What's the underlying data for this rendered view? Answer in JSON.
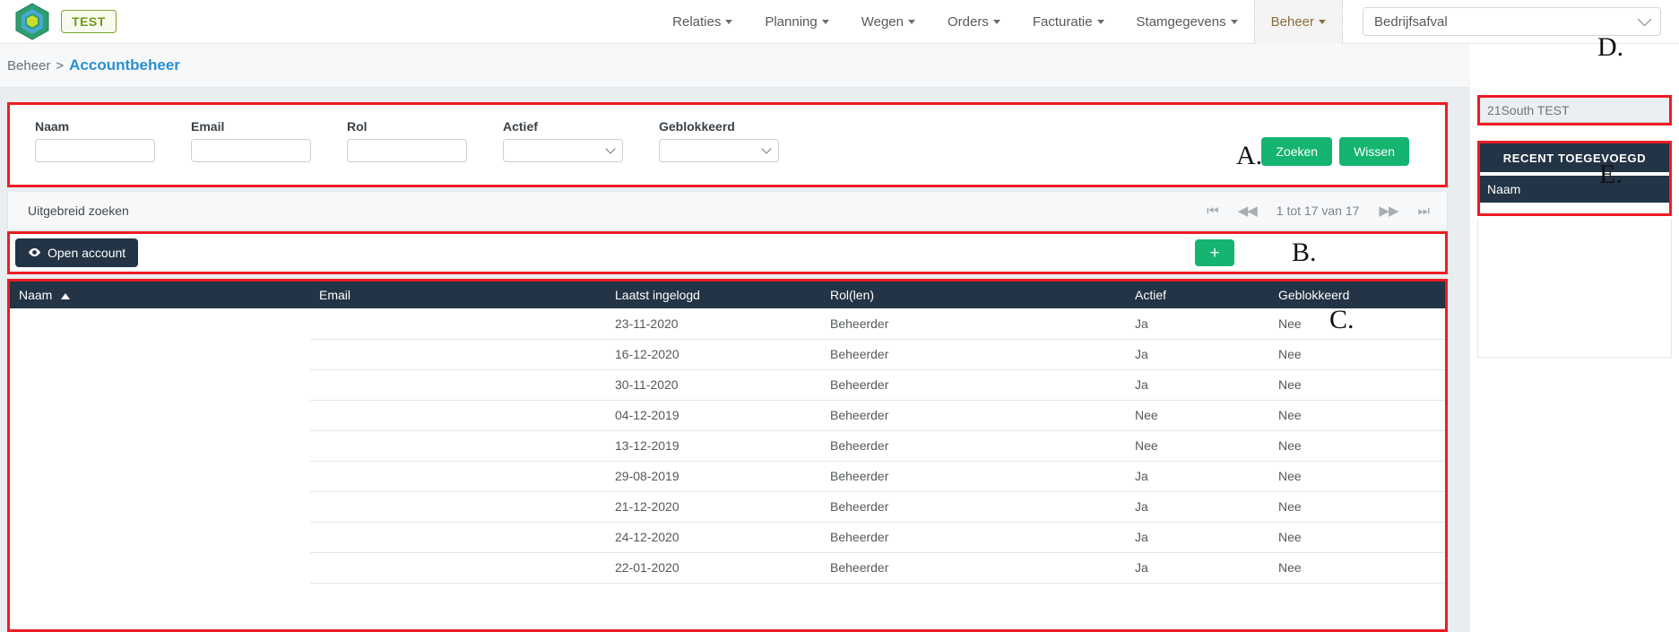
{
  "topnav": {
    "badge": "TEST",
    "items": [
      {
        "label": "Relaties",
        "active": false
      },
      {
        "label": "Planning",
        "active": false
      },
      {
        "label": "Wegen",
        "active": false
      },
      {
        "label": "Orders",
        "active": false
      },
      {
        "label": "Facturatie",
        "active": false
      },
      {
        "label": "Stamgegevens",
        "active": false
      },
      {
        "label": "Beheer",
        "active": true
      }
    ],
    "org_select_value": "Bedrijfsafval"
  },
  "breadcrumb": {
    "root": "Beheer",
    "separator": ">",
    "current": "Accountbeheer"
  },
  "filter": {
    "fields": [
      {
        "label": "Naam",
        "type": "input",
        "value": ""
      },
      {
        "label": "Email",
        "type": "input",
        "value": ""
      },
      {
        "label": "Rol",
        "type": "input",
        "value": ""
      },
      {
        "label": "Actief",
        "type": "select",
        "value": ""
      },
      {
        "label": "Geblokkeerd",
        "type": "select",
        "value": ""
      }
    ],
    "search_button": "Zoeken",
    "clear_button": "Wissen",
    "marker": "A."
  },
  "advanced": {
    "label": "Uitgebreid zoeken",
    "pager": {
      "first": "⏮",
      "prev": "◀◀",
      "range": "1 tot 17 van 17",
      "next": "▶▶",
      "last": "⏭"
    }
  },
  "toolbar": {
    "open_account_label": "Open account",
    "open_account_icon": "eye-icon",
    "add_label": "+",
    "marker": "B."
  },
  "table": {
    "marker": "C.",
    "sorted_column": "Naam",
    "sort_direction": "asc",
    "columns": [
      "Naam",
      "Email",
      "Laatst ingelogd",
      "Rol(len)",
      "Actief",
      "Geblokkeerd"
    ],
    "rows": [
      {
        "naam": "",
        "email": "",
        "laatst_ingelogd": "23-11-2020",
        "rollen": "Beheerder",
        "actief": "Ja",
        "geblokkeerd": "Nee"
      },
      {
        "naam": "",
        "email": "",
        "laatst_ingelogd": "16-12-2020",
        "rollen": "Beheerder",
        "actief": "Ja",
        "geblokkeerd": "Nee"
      },
      {
        "naam": "",
        "email": "",
        "laatst_ingelogd": "30-11-2020",
        "rollen": "Beheerder",
        "actief": "Ja",
        "geblokkeerd": "Nee"
      },
      {
        "naam": "",
        "email": "",
        "laatst_ingelogd": "04-12-2019",
        "rollen": "Beheerder",
        "actief": "Nee",
        "geblokkeerd": "Nee"
      },
      {
        "naam": "",
        "email": "",
        "laatst_ingelogd": "13-12-2019",
        "rollen": "Beheerder",
        "actief": "Nee",
        "geblokkeerd": "Nee"
      },
      {
        "naam": "",
        "email": "",
        "laatst_ingelogd": "29-08-2019",
        "rollen": "Beheerder",
        "actief": "Ja",
        "geblokkeerd": "Nee"
      },
      {
        "naam": "",
        "email": "",
        "laatst_ingelogd": "21-12-2020",
        "rollen": "Beheerder",
        "actief": "Ja",
        "geblokkeerd": "Nee"
      },
      {
        "naam": "",
        "email": "",
        "laatst_ingelogd": "24-12-2020",
        "rollen": "Beheerder",
        "actief": "Ja",
        "geblokkeerd": "Nee"
      },
      {
        "naam": "",
        "email": "",
        "laatst_ingelogd": "22-01-2020",
        "rollen": "Beheerder",
        "actief": "Ja",
        "geblokkeerd": "Nee"
      }
    ]
  },
  "sidebar": {
    "search_value": "21South TEST",
    "marker_d": "D.",
    "card_title": "RECENT TOEGEVOEGD",
    "card_column": "Naam",
    "marker_e": "E."
  },
  "colors": {
    "accent_green": "#15b471",
    "dark_navy": "#223445",
    "annotation_red": "#ee1c25",
    "link_blue": "#2a8fd0"
  }
}
